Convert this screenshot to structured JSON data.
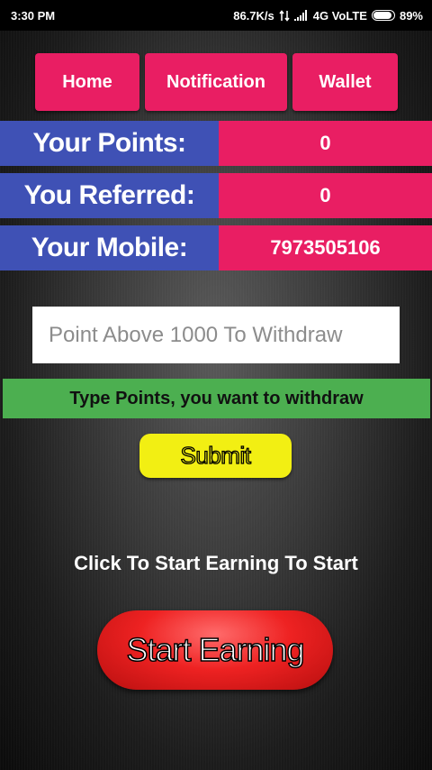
{
  "status_bar": {
    "time": "3:30 PM",
    "network_speed": "86.7K/s",
    "network": "4G VoLTE",
    "battery": "89%",
    "battery_level": 0.89
  },
  "nav": {
    "home": "Home",
    "notification": "Notification",
    "wallet": "Wallet"
  },
  "stats": {
    "points_label": "Your Points:",
    "points_value": "0",
    "referred_label": "You Referred:",
    "referred_value": "0",
    "mobile_label": "Your Mobile:",
    "mobile_value": "7973505106"
  },
  "withdraw": {
    "placeholder": "Point Above 1000 To Withdraw",
    "hint": "Type Points, you want to withdraw",
    "submit_label": "Submit"
  },
  "earning": {
    "label": "Click To Start Earning To Start",
    "button_label": "Start Earning"
  },
  "colors": {
    "pink": "#e91e63",
    "blue": "#3f51b5",
    "green": "#4caf50",
    "yellow": "#f2ef13",
    "red": "#ee2222"
  }
}
